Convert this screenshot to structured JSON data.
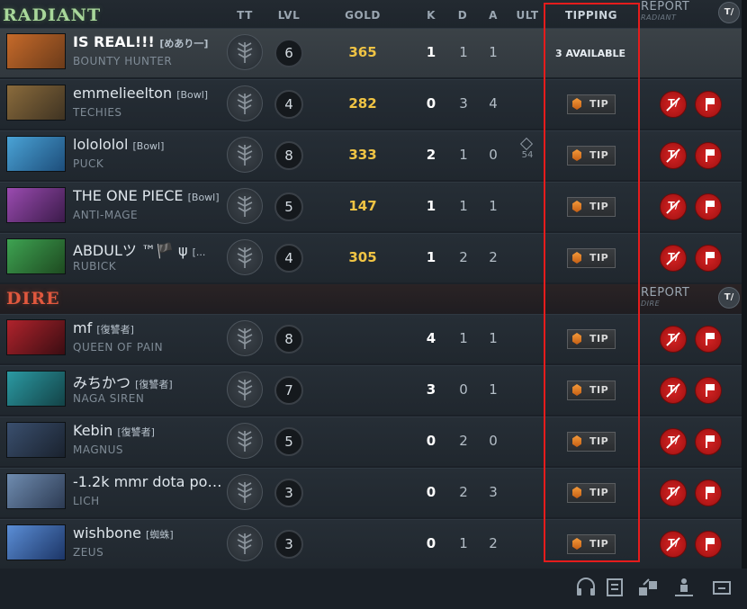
{
  "columns": {
    "tt": "TT",
    "lvl": "LVL",
    "gold": "GOLD",
    "k": "K",
    "d": "D",
    "a": "A",
    "ult": "ULT",
    "tipping": "TIPPING"
  },
  "radiant": {
    "title": "RADIANT",
    "report_label": "REPORT",
    "report_sub": "RADIANT",
    "mute_all_label": "T/",
    "players": [
      {
        "name": "IS REAL!!!",
        "tag": "[めあり一]",
        "hero": "BOUNTY HUNTER",
        "level": "6",
        "gold": "365",
        "k": "1",
        "d": "1",
        "a": "1",
        "ult": "",
        "tip_status": "3 AVAILABLE"
      },
      {
        "name": "emmelieelton",
        "tag": "[Bowl]",
        "hero": "TECHIES",
        "level": "4",
        "gold": "282",
        "k": "0",
        "d": "3",
        "a": "4",
        "ult": "",
        "tip_label": "TIP"
      },
      {
        "name": "lolololol",
        "tag": "[Bowl]",
        "hero": "PUCK",
        "level": "8",
        "gold": "333",
        "k": "2",
        "d": "1",
        "a": "0",
        "ult": "54",
        "tip_label": "TIP"
      },
      {
        "name": "THE ONE PIECE",
        "tag": "[Bowl]",
        "hero": "ANTI-MAGE",
        "level": "5",
        "gold": "147",
        "k": "1",
        "d": "1",
        "a": "1",
        "ult": "",
        "tip_label": "TIP"
      },
      {
        "name": "ABDULツ ™🏴 ψ",
        "tag": "[...",
        "hero": "RUBICK",
        "level": "4",
        "gold": "305",
        "k": "1",
        "d": "2",
        "a": "2",
        "ult": "",
        "tip_label": "TIP"
      }
    ]
  },
  "dire": {
    "title": "DIRE",
    "report_label": "REPORT",
    "report_sub": "DIRE",
    "mute_all_label": "T/",
    "players": [
      {
        "name": "mf",
        "tag": "[復讐者]",
        "hero": "QUEEN OF PAIN",
        "level": "8",
        "gold": "",
        "k": "4",
        "d": "1",
        "a": "1",
        "tip_label": "TIP"
      },
      {
        "name": "みちかつ",
        "tag": "[復讐者]",
        "hero": "NAGA SIREN",
        "level": "7",
        "gold": "",
        "k": "3",
        "d": "0",
        "a": "1",
        "tip_label": "TIP"
      },
      {
        "name": "Kebin",
        "tag": "[復讐者]",
        "hero": "MAGNUS",
        "level": "5",
        "gold": "",
        "k": "0",
        "d": "2",
        "a": "0",
        "tip_label": "TIP"
      },
      {
        "name": "-1.2k mmr dota po…",
        "tag": "",
        "hero": "LICH",
        "level": "3",
        "gold": "",
        "k": "0",
        "d": "2",
        "a": "3",
        "tip_label": "TIP"
      },
      {
        "name": "wishbone",
        "tag": "[蜘蛛]",
        "hero": "ZEUS",
        "level": "3",
        "gold": "",
        "k": "0",
        "d": "1",
        "a": "2",
        "tip_label": "TIP"
      }
    ]
  },
  "row_actions": {
    "mute_label": "T/"
  },
  "bottom_icons": [
    "headset-icon",
    "scoreboard-icon",
    "share-items-icon",
    "unit-control-icon",
    "minimize-icon"
  ],
  "colors": {
    "gold": "#f0c444",
    "radiant": "#a8d79a",
    "dire": "#e0583e",
    "report_red": "#d42323",
    "highlight": "#e51c1c"
  }
}
